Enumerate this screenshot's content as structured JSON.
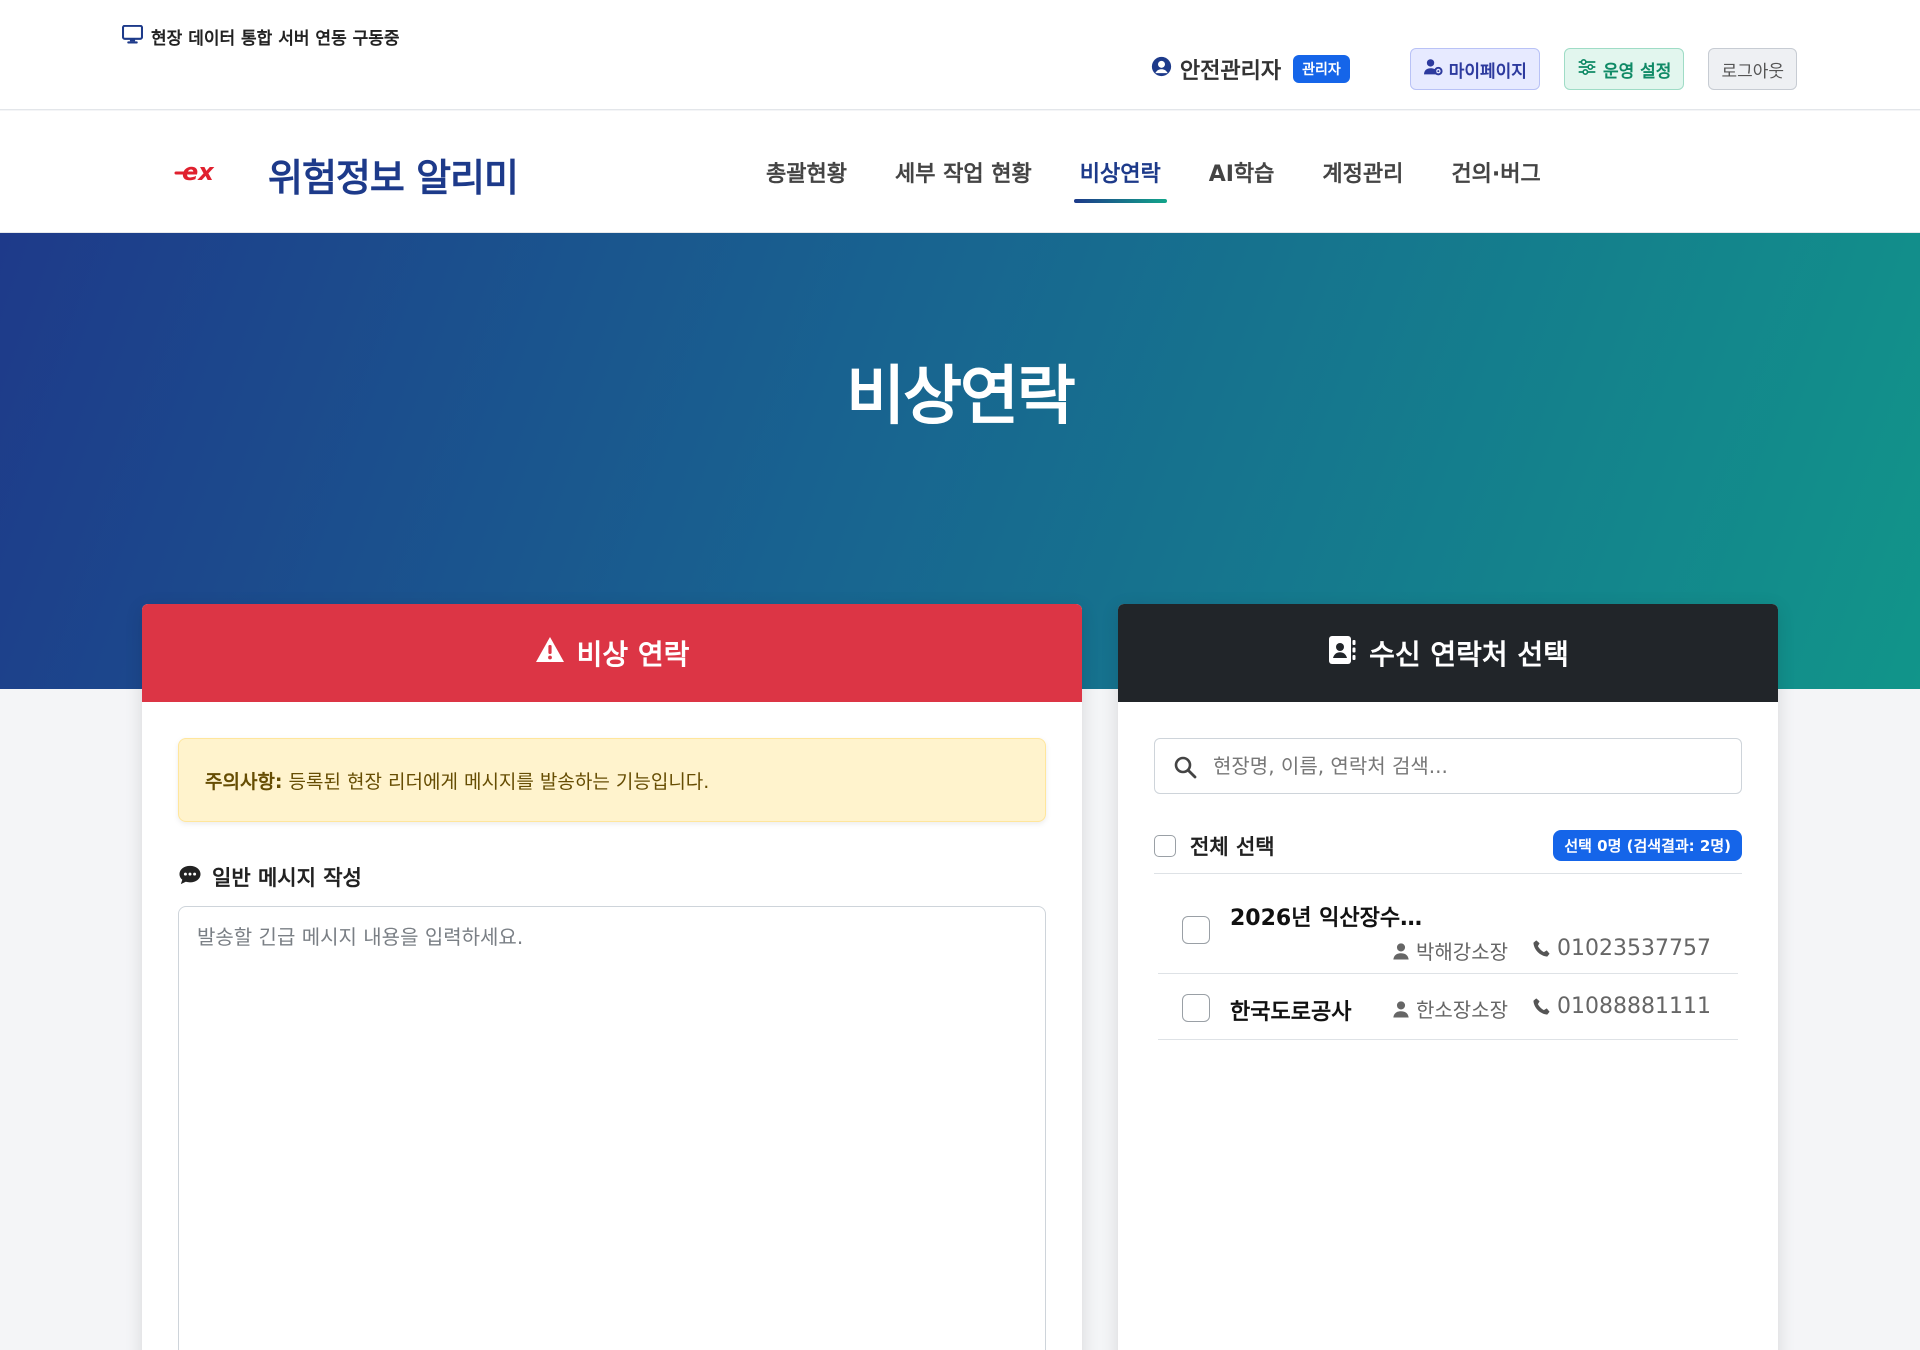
{
  "topbar": {
    "server_status": "현장 데이터 통합 서버 연동 구동중",
    "user_name": "안전관리자",
    "role_badge": "관리자",
    "mypage_label": "마이페이지",
    "settings_label": "운영 설정",
    "logout_label": "로그아웃"
  },
  "navbar": {
    "logo_text": "ex",
    "brand": "위험정보 알리미",
    "items": [
      {
        "label": "총괄현황"
      },
      {
        "label": "세부 작업 현황"
      },
      {
        "label": "비상연락"
      },
      {
        "label": "AI학습"
      },
      {
        "label": "계정관리"
      },
      {
        "label": "건의·버그"
      }
    ],
    "active_item": "비상연락"
  },
  "hero": {
    "title": "비상연락"
  },
  "emergency_panel": {
    "header": "비상 연락",
    "alert_label": "주의사항:",
    "alert_text": "등록된 현장 리더에게 메시지를 발송하는 기능입니다.",
    "message_label": "일반 메시지 작성",
    "message_placeholder": "발송할 긴급 메시지 내용을 입력하세요.",
    "message_value": ""
  },
  "recipient_panel": {
    "header": "수신 연락처 선택",
    "search_placeholder": "현장명, 이름, 연락처 검색...",
    "search_value": "",
    "select_all_label": "전체 선택",
    "count_badge": "선택 0명 (검색결과: 2명)",
    "contacts": [
      {
        "site": "2026년 익산장수…",
        "person": "박해강소장",
        "phone": "01023537757",
        "checked": false
      },
      {
        "site": "한국도로공사",
        "person": "한소장소장",
        "phone": "01088881111",
        "checked": false
      }
    ]
  },
  "colors": {
    "brand_navy": "#1d3a8a",
    "accent_teal": "#12a58a",
    "danger_red": "#dc3545",
    "dark_header": "#212529",
    "primary_blue": "#1565e9",
    "alert_bg": "#fff3cd"
  },
  "icons": [
    "monitor-icon",
    "user-circle-icon",
    "user-gear-icon",
    "sliders-icon",
    "warning-icon",
    "address-book-icon",
    "comment-icon",
    "search-icon",
    "user-icon",
    "phone-icon"
  ]
}
